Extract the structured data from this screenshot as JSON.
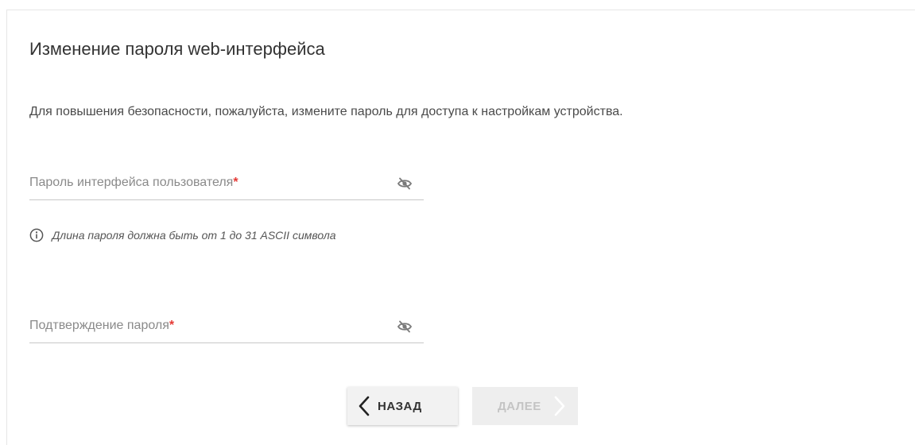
{
  "page": {
    "title": "Изменение пароля web-интерфейса",
    "description": "Для повышения безопасности, пожалуйста, измените пароль для доступа к настройкам устройства."
  },
  "fields": {
    "password": {
      "label": "Пароль интерфейса пользователя",
      "required_mark": "*",
      "value": "",
      "icon": "eye-off-icon"
    },
    "confirm": {
      "label": "Подтверждение пароля",
      "required_mark": "*",
      "value": "",
      "icon": "eye-off-icon"
    }
  },
  "hint": {
    "icon": "info-icon",
    "text": "Длина пароля должна быть от 1 до 31 ASCII символа"
  },
  "buttons": {
    "back_label": "НАЗАД",
    "next_label": "ДАЛЕЕ"
  },
  "colors": {
    "required": "#e53935",
    "divider": "#c8c8c8",
    "disabled_text": "#c4c4c4"
  }
}
